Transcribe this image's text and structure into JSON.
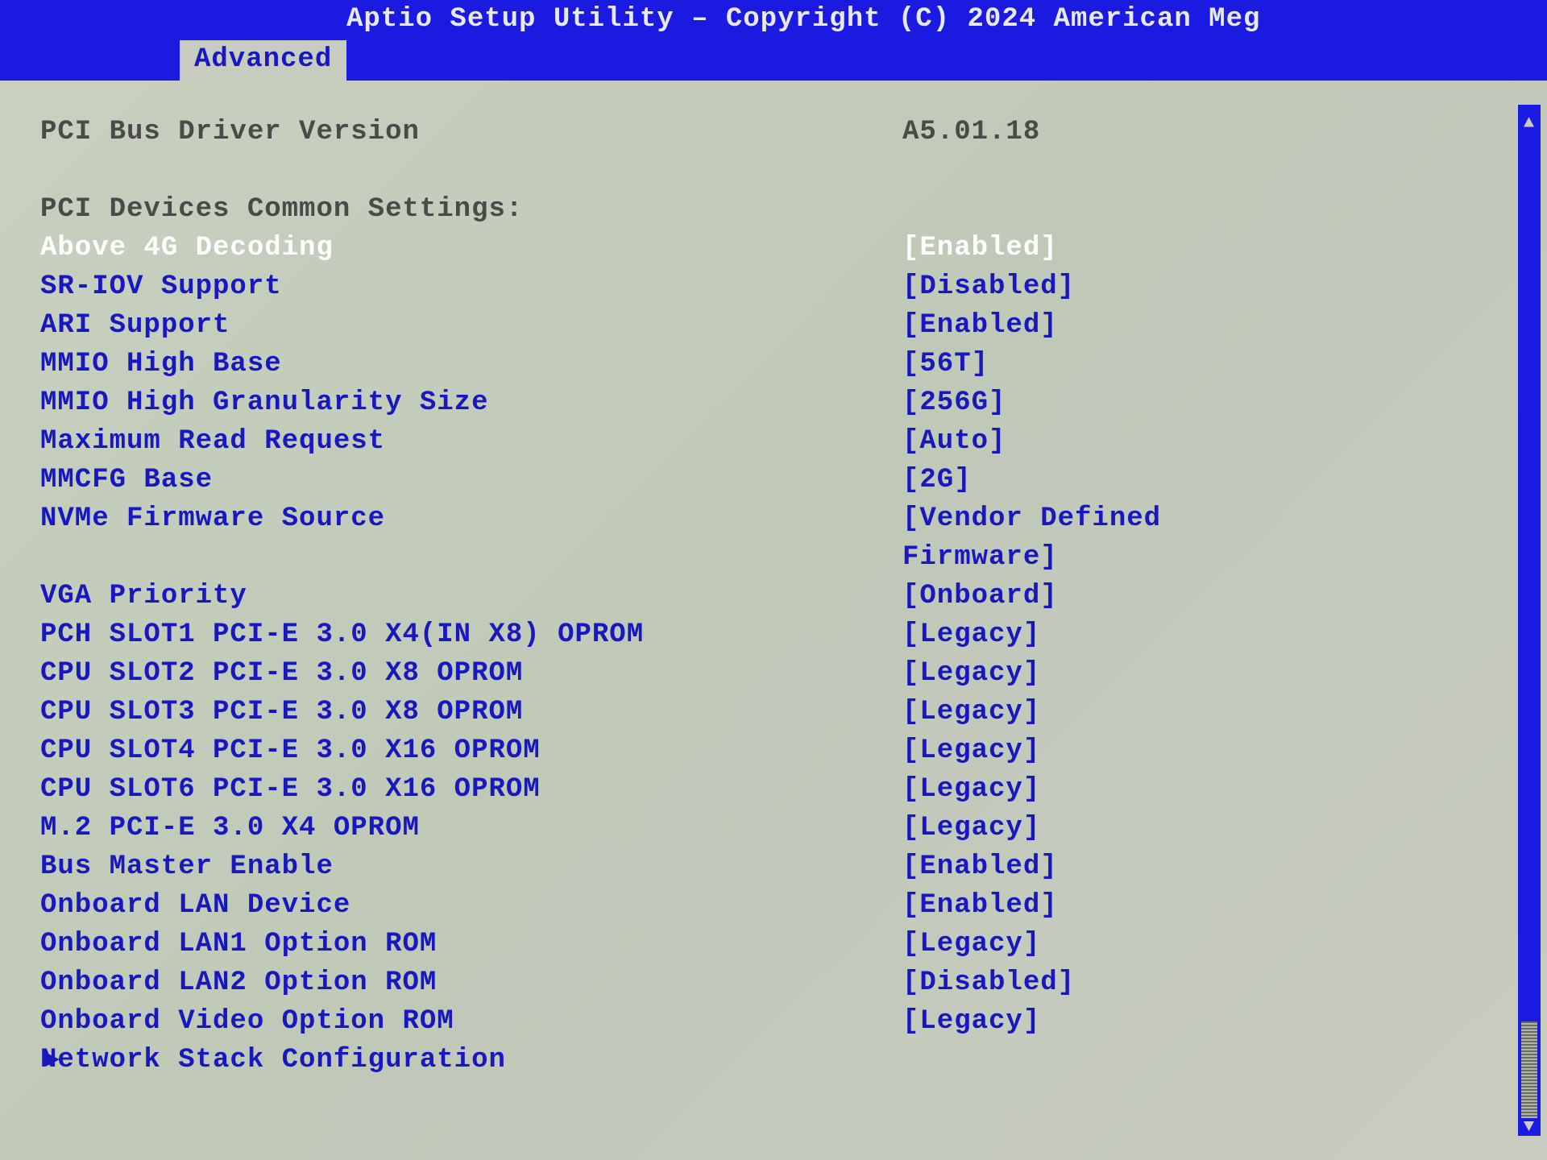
{
  "header": {
    "title": "Aptio Setup Utility – Copyright (C) 2024 American Meg"
  },
  "tabs": {
    "active": "Advanced"
  },
  "info_rows": [
    {
      "label": "PCI Bus Driver Version",
      "value": "A5.01.18"
    }
  ],
  "section_header": "PCI Devices Common Settings:",
  "settings": [
    {
      "label": "Above 4G Decoding",
      "value": "[Enabled]",
      "selected": true
    },
    {
      "label": "SR-IOV Support",
      "value": "[Disabled]",
      "selected": false
    },
    {
      "label": "ARI Support",
      "value": "[Enabled]",
      "selected": false
    },
    {
      "label": "MMIO High Base",
      "value": "[56T]",
      "selected": false
    },
    {
      "label": "MMIO High Granularity Size",
      "value": "[256G]",
      "selected": false
    },
    {
      "label": "Maximum Read Request",
      "value": "[Auto]",
      "selected": false
    },
    {
      "label": "MMCFG Base",
      "value": "[2G]",
      "selected": false
    },
    {
      "label": "NVMe Firmware Source",
      "value": "[Vendor Defined Firmware]",
      "selected": false
    },
    {
      "label": "VGA Priority",
      "value": "[Onboard]",
      "selected": false
    },
    {
      "label": "PCH SLOT1 PCI-E 3.0 X4(IN X8) OPROM",
      "value": "[Legacy]",
      "selected": false
    },
    {
      "label": "CPU SLOT2 PCI-E 3.0 X8 OPROM",
      "value": "[Legacy]",
      "selected": false
    },
    {
      "label": "CPU SLOT3 PCI-E 3.0 X8 OPROM",
      "value": "[Legacy]",
      "selected": false
    },
    {
      "label": "CPU SLOT4 PCI-E 3.0 X16 OPROM",
      "value": "[Legacy]",
      "selected": false
    },
    {
      "label": "CPU SLOT6 PCI-E 3.0 X16 OPROM",
      "value": "[Legacy]",
      "selected": false
    },
    {
      "label": "M.2 PCI-E 3.0 X4 OPROM",
      "value": "[Legacy]",
      "selected": false
    },
    {
      "label": "Bus Master Enable",
      "value": "[Enabled]",
      "selected": false
    },
    {
      "label": "Onboard LAN Device",
      "value": "[Enabled]",
      "selected": false
    },
    {
      "label": "Onboard LAN1 Option ROM",
      "value": "[Legacy]",
      "selected": false
    },
    {
      "label": "Onboard LAN2 Option ROM",
      "value": "[Disabled]",
      "selected": false
    },
    {
      "label": "Onboard Video Option ROM",
      "value": "[Legacy]",
      "selected": false
    }
  ],
  "submenus": [
    {
      "label": "Network Stack Configuration"
    }
  ],
  "icons": {
    "submenu_marker": "▶",
    "scroll_up": "▲",
    "scroll_down": "▼"
  }
}
